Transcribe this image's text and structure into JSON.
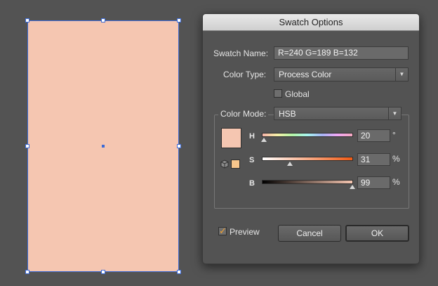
{
  "canvas": {
    "shape_fill": "#f5c6b1",
    "selection_color": "#3d6bd6"
  },
  "dialog": {
    "title": "Swatch Options",
    "swatch_name_label": "Swatch Name:",
    "swatch_name_value": "R=240 G=189 B=132",
    "color_type_label": "Color Type:",
    "color_type_value": "Process Color",
    "global_label": "Global",
    "global_checked": false,
    "color_mode_label": "Color Mode:",
    "color_mode_value": "HSB",
    "swatch_color": "#f5c6b1",
    "small_swatch_color": "#f7c68c",
    "channels": [
      {
        "label": "H",
        "value": "20",
        "unit": "°",
        "fraction": 0.02
      },
      {
        "label": "S",
        "value": "31",
        "unit": "%",
        "fraction": 0.31
      },
      {
        "label": "B",
        "value": "99",
        "unit": "%",
        "fraction": 0.99
      }
    ],
    "preview_label": "Preview",
    "preview_checked": true,
    "cancel_label": "Cancel",
    "ok_label": "OK"
  }
}
